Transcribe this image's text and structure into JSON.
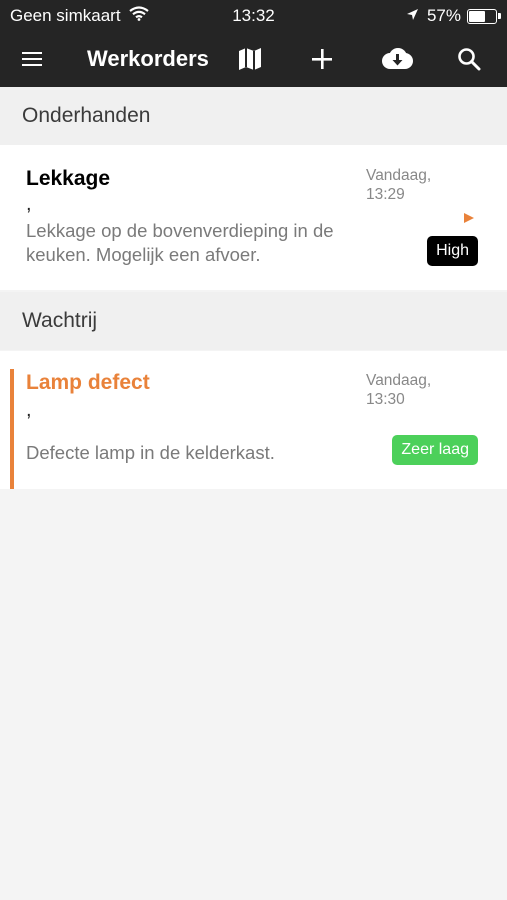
{
  "status_bar": {
    "carrier": "Geen simkaart",
    "time": "13:32",
    "battery_text": "57%",
    "battery_level": 0.57,
    "icons": [
      "wifi-icon",
      "location-arrow-icon",
      "battery-icon"
    ]
  },
  "app_bar": {
    "title": "Werkorders",
    "icons": [
      "menu-icon",
      "map-icon",
      "plus-icon",
      "cloud-download-icon",
      "search-icon"
    ]
  },
  "sections": [
    {
      "header": "Onderhanden",
      "items": [
        {
          "title": "Lekkage",
          "subtitle": ",",
          "description": "Lekkage op de bovenverdieping in de keuken. Mogelijk een afvoer.",
          "date_line1": "Vandaag,",
          "date_line2": "13:29",
          "priority": "High",
          "priority_color": "#000000",
          "title_color": "#000000",
          "play_icon_color": "#e9823a"
        }
      ]
    },
    {
      "header": "Wachtrij",
      "items": [
        {
          "title": "Lamp defect",
          "subtitle": ",",
          "description": "Defecte lamp in de kelderkast.",
          "date_line1": "Vandaag,",
          "date_line2": "13:30",
          "priority": "Zeer laag",
          "priority_color": "#4cd05a",
          "title_color": "#e9823a",
          "accent_color": "#e9823a"
        }
      ]
    }
  ]
}
